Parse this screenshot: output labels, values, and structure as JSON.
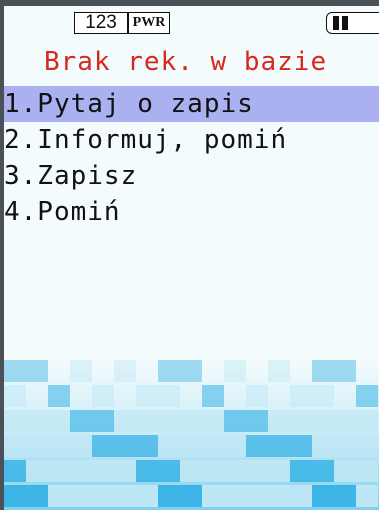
{
  "status": {
    "mode_indicator": "123",
    "power_indicator": "PWR",
    "battery_icon": "battery-icon"
  },
  "title": "Brak rek. w bazie",
  "menu": {
    "selected_index": 0,
    "items": [
      {
        "label": "1.Pytaj o zapis"
      },
      {
        "label": "2.Informuj, pomiń"
      },
      {
        "label": "3.Zapisz"
      },
      {
        "label": "4.Pomiń"
      }
    ]
  },
  "colors": {
    "title": "#d4291c",
    "selection": "#aab0f0",
    "frame": "#4a5157",
    "tile_light": "#bfe7f5",
    "tile_dark": "#39b3e6"
  }
}
